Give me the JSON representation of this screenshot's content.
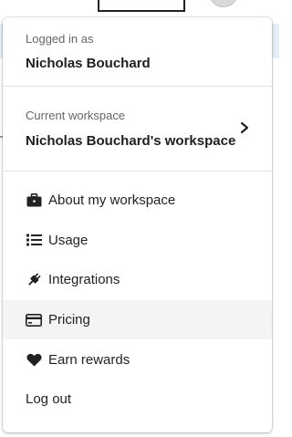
{
  "account": {
    "logged_in_caption": "Logged in as",
    "user_name": "Nicholas Bouchard"
  },
  "workspace": {
    "caption": "Current workspace",
    "name": "Nicholas Bouchard's workspace",
    "icon": "chevron-right-icon"
  },
  "menu": {
    "items": [
      {
        "label": "About my workspace",
        "icon": "briefcase-icon"
      },
      {
        "label": "Usage",
        "icon": "list-icon"
      },
      {
        "label": "Integrations",
        "icon": "plug-icon"
      },
      {
        "label": "Pricing",
        "icon": "credit-card-icon",
        "highlighted": true
      },
      {
        "label": "Earn rewards",
        "icon": "heart-icon"
      },
      {
        "label": "Log out"
      }
    ]
  },
  "colors": {
    "highlight_bg": "#f4f4f4",
    "background_band": "#e4eef7",
    "text": "#222222",
    "caption": "#666666"
  }
}
